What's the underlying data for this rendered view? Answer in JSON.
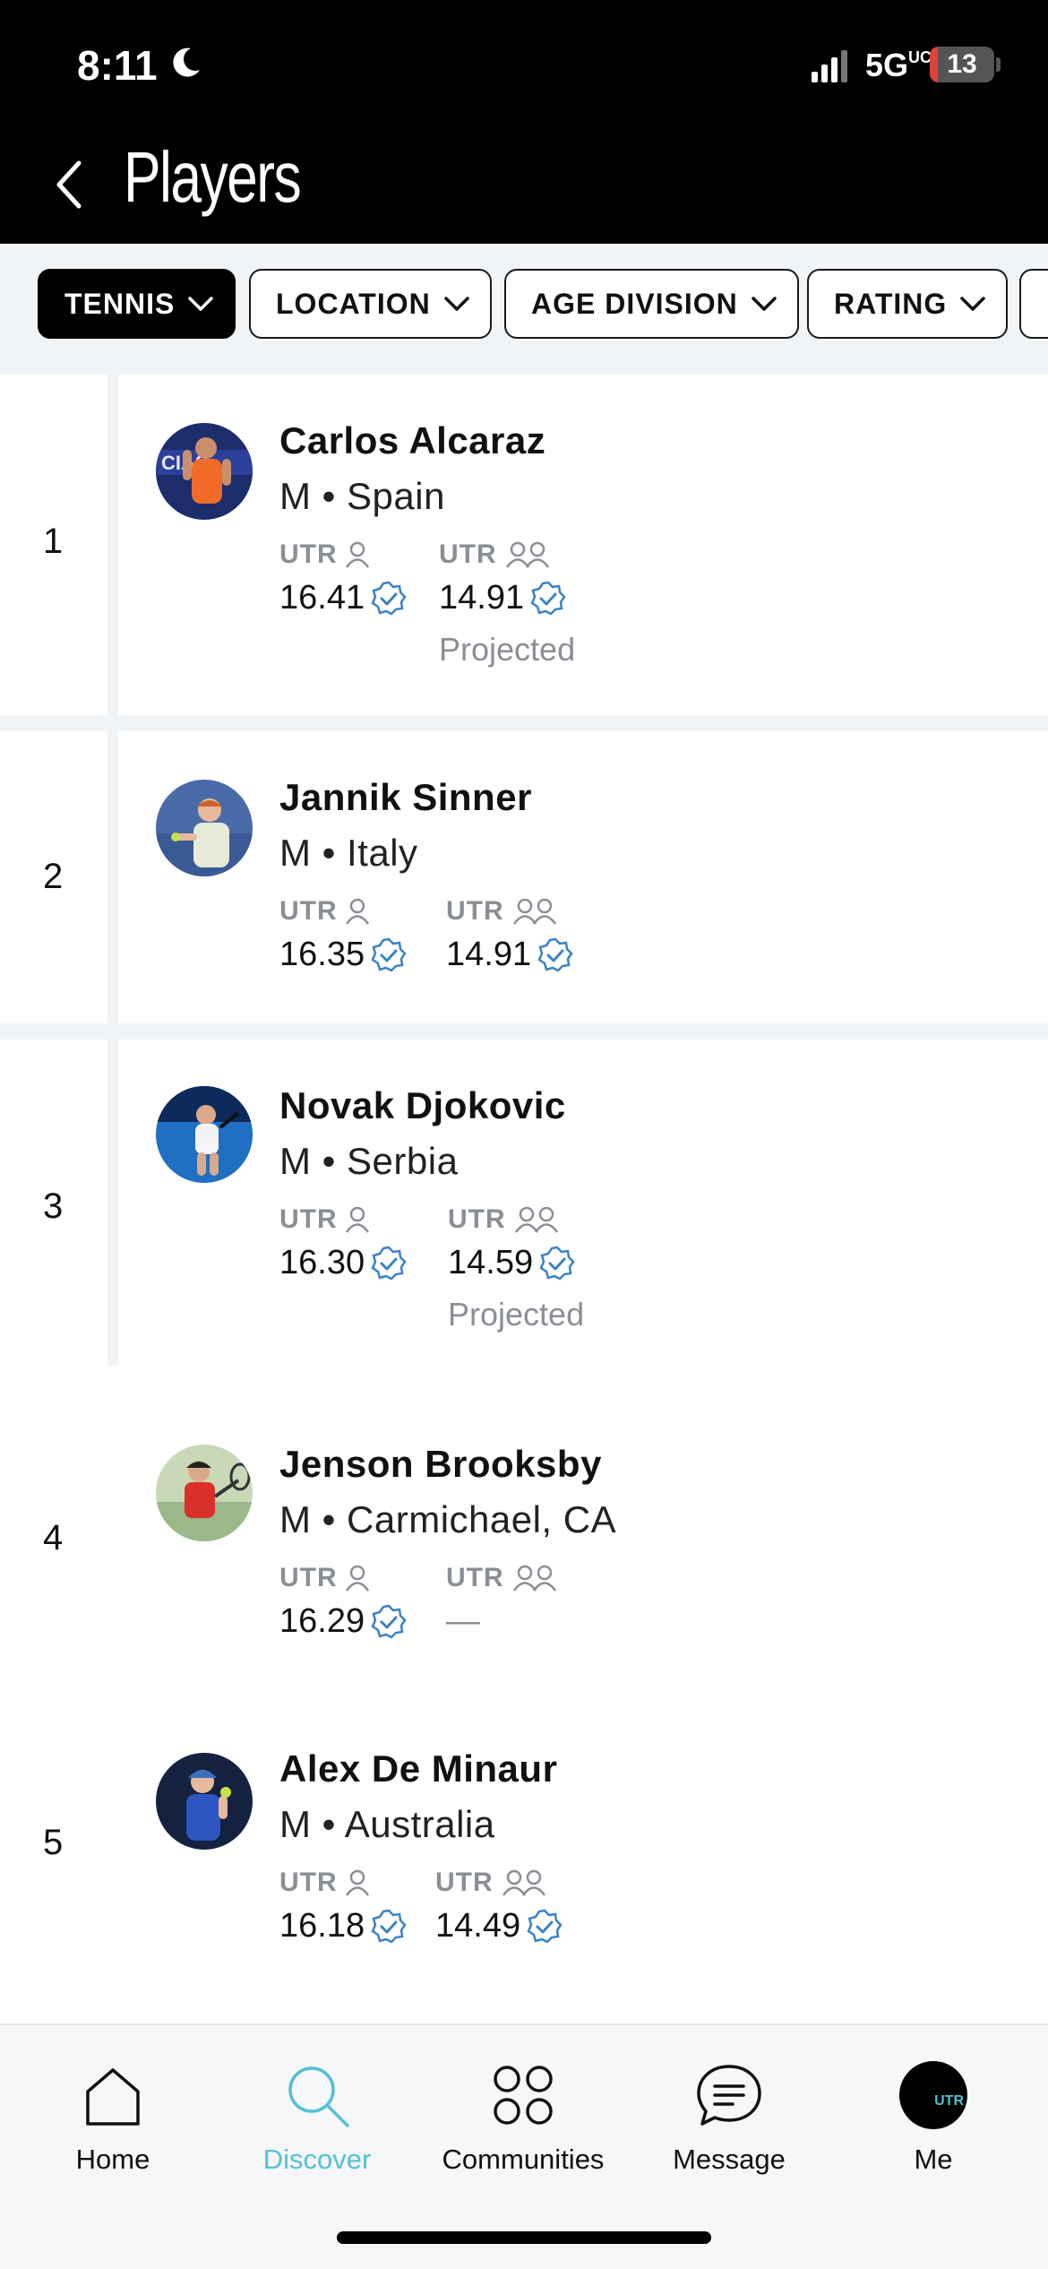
{
  "status_bar": {
    "time": "8:11",
    "network": "5G",
    "network_sup": "UC",
    "battery_level": "13",
    "battery_fraction": 0.13
  },
  "header": {
    "title": "Players"
  },
  "filters": [
    {
      "label": "TENNIS",
      "active": true
    },
    {
      "label": "LOCATION",
      "active": false
    },
    {
      "label": "AGE DIVISION",
      "active": false
    },
    {
      "label": "RATING",
      "active": false
    }
  ],
  "players": [
    {
      "rank": "1",
      "name": "Carlos Alcaraz",
      "meta": "M • Spain",
      "singles_label": "UTR",
      "singles": "16.41",
      "doubles_label": "UTR",
      "doubles": "14.91",
      "note": "Projected"
    },
    {
      "rank": "2",
      "name": "Jannik Sinner",
      "meta": "M • Italy",
      "singles_label": "UTR",
      "singles": "16.35",
      "doubles_label": "UTR",
      "doubles": "14.91",
      "note": ""
    },
    {
      "rank": "3",
      "name": "Novak Djokovic",
      "meta": "M • Serbia",
      "singles_label": "UTR",
      "singles": "16.30",
      "doubles_label": "UTR",
      "doubles": "14.59",
      "note": "Projected"
    },
    {
      "rank": "4",
      "name": "Jenson Brooksby",
      "meta": "M • Carmichael, CA",
      "singles_label": "UTR",
      "singles": "16.29",
      "doubles_label": "UTR",
      "doubles": "—",
      "note": ""
    },
    {
      "rank": "5",
      "name": "Alex De Minaur",
      "meta": "M • Australia",
      "singles_label": "UTR",
      "singles": "16.18",
      "doubles_label": "UTR",
      "doubles": "14.49",
      "note": ""
    }
  ],
  "tabbar": {
    "home": "Home",
    "discover": "Discover",
    "communities": "Communities",
    "message": "Message",
    "me": "Me",
    "me_avatar_text": "UTR"
  },
  "colors": {
    "accent": "#53c1d6",
    "verified": "#3b82c4",
    "header_bg": "#000000",
    "separator": "#f1f4f7"
  }
}
